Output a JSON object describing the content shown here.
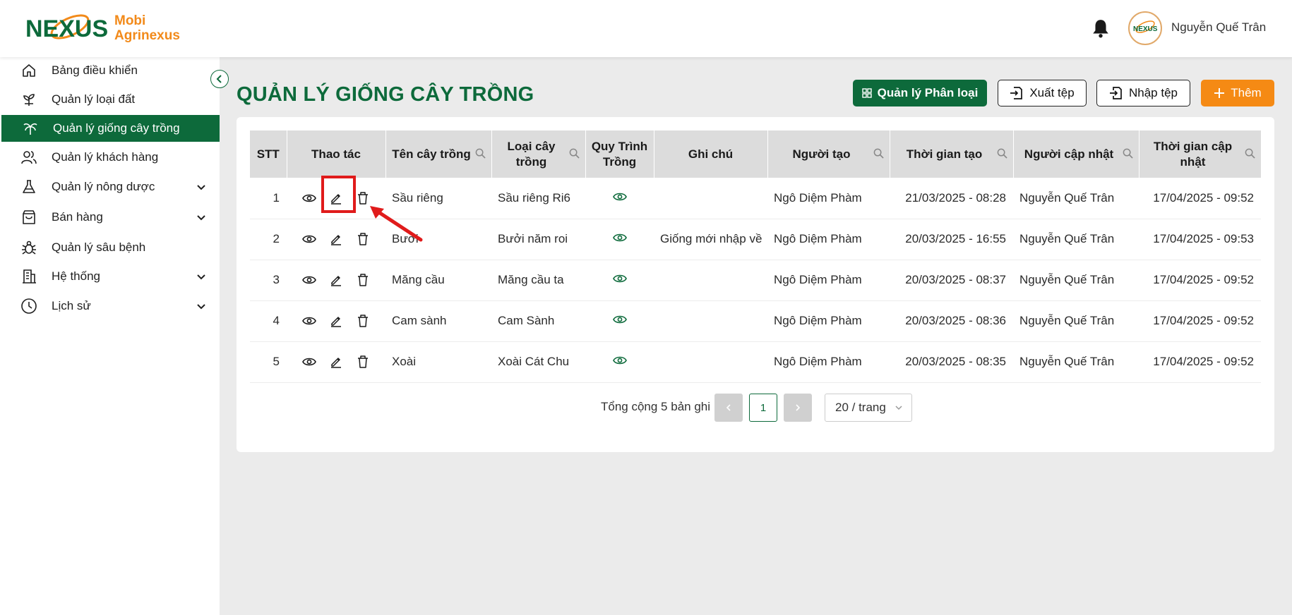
{
  "brand": {
    "line1": "Mobi",
    "line2": "Agrinexus",
    "logo_text": "NEXUS"
  },
  "header": {
    "user_name": "Nguyễn Quế Trân",
    "avatar_text": "NEXUS"
  },
  "sidebar": {
    "items": [
      {
        "label": "Bảng điều khiển",
        "icon": "home-icon"
      },
      {
        "label": "Quản lý loại đất",
        "icon": "sprout-icon"
      },
      {
        "label": "Quản lý giống cây trồng",
        "icon": "palm-tree-icon",
        "active": true
      },
      {
        "label": "Quản lý khách hàng",
        "icon": "users-icon"
      },
      {
        "label": "Quản lý nông dược",
        "icon": "flask-icon",
        "expandable": true
      },
      {
        "label": "Bán hàng",
        "icon": "shopping-bag-icon",
        "expandable": true
      },
      {
        "label": "Quản lý sâu bệnh",
        "icon": "bug-icon"
      },
      {
        "label": "Hệ thống",
        "icon": "building-icon",
        "expandable": true
      },
      {
        "label": "Lịch sử",
        "icon": "clock-icon",
        "expandable": true
      }
    ]
  },
  "page": {
    "title": "QUẢN LÝ GIỐNG CÂY TRỒNG",
    "buttons": {
      "classify": "Quản lý Phân loại",
      "export": "Xuất tệp",
      "import": "Nhập tệp",
      "add": "Thêm"
    }
  },
  "table": {
    "columns": [
      "STT",
      "Thao tác",
      "Tên cây trồng",
      "Loại cây trồng",
      "Quy Trình Trồng",
      "Ghi chú",
      "Người tạo",
      "Thời gian tạo",
      "Người cập nhật",
      "Thời gian cập nhật"
    ],
    "rows": [
      {
        "stt": "1",
        "name": "Sầu riêng",
        "type": "Sầu riêng Ri6",
        "note": "",
        "creator": "Ngô Diệm Phàm",
        "created": "21/03/2025 - 08:28",
        "updater": "Nguyễn Quế Trân",
        "updated": "17/04/2025 - 09:52"
      },
      {
        "stt": "2",
        "name": "Bưởi",
        "type": "Bưởi năm roi",
        "note": "Giống mới nhập về",
        "creator": "Ngô Diệm Phàm",
        "created": "20/03/2025 - 16:55",
        "updater": "Nguyễn Quế Trân",
        "updated": "17/04/2025 - 09:53"
      },
      {
        "stt": "3",
        "name": "Măng cầu",
        "type": "Măng cầu ta",
        "note": "",
        "creator": "Ngô Diệm Phàm",
        "created": "20/03/2025 - 08:37",
        "updater": "Nguyễn Quế Trân",
        "updated": "17/04/2025 - 09:52"
      },
      {
        "stt": "4",
        "name": "Cam sành",
        "type": "Cam Sành",
        "note": "",
        "creator": "Ngô Diệm Phàm",
        "created": "20/03/2025 - 08:36",
        "updater": "Nguyễn Quế Trân",
        "updated": "17/04/2025 - 09:52"
      },
      {
        "stt": "5",
        "name": "Xoài",
        "type": "Xoài Cát Chu",
        "note": "",
        "creator": "Ngô Diệm Phàm",
        "created": "20/03/2025 - 08:35",
        "updater": "Nguyễn Quế Trân",
        "updated": "17/04/2025 - 09:52"
      }
    ]
  },
  "pagination": {
    "total": "Tổng cộng 5 bản ghi",
    "current": "1",
    "page_size": "20 / trang"
  },
  "colors": {
    "primary": "#0d6a3b",
    "accent": "#f58a14",
    "highlight": "#e01b1b"
  }
}
